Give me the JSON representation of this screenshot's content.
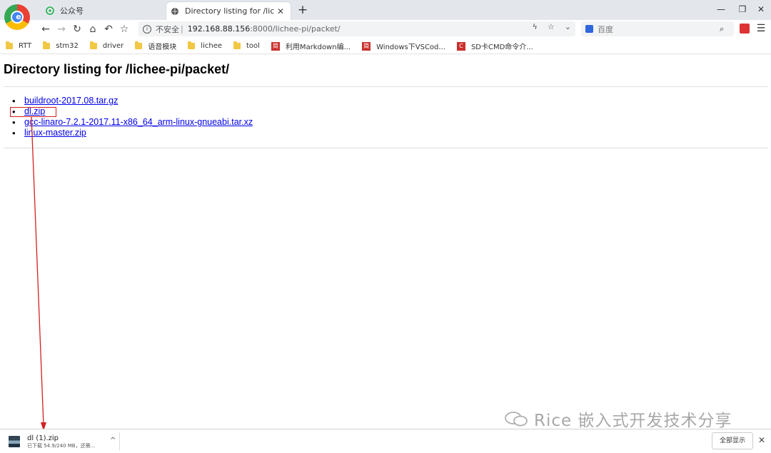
{
  "tabs": [
    {
      "title": "公众号",
      "icon": "wechat-icon"
    },
    {
      "title": "Directory listing for /lichee-pi/",
      "icon": "globe-icon",
      "close": "✕"
    }
  ],
  "new_tab": "+",
  "window_controls": [
    "—",
    "❐",
    "✕"
  ],
  "nav": {
    "back": "←",
    "forward": "→",
    "reload": "↻",
    "home": "⌂",
    "undo": "↶",
    "star": "☆"
  },
  "address": {
    "insecure_label": "不安全",
    "separator": "|",
    "host": "192.168.88.156",
    "rest": ":8000/lichee-pi/packet/"
  },
  "omni_icons": {
    "bolt": "ϟ",
    "star": "☆",
    "chevron": "⌄"
  },
  "search": {
    "placeholder": "百度",
    "button": "⌕"
  },
  "menu": "☰",
  "bookmarks": [
    {
      "label": "RTT",
      "type": "folder"
    },
    {
      "label": "stm32",
      "type": "folder"
    },
    {
      "label": "driver",
      "type": "folder"
    },
    {
      "label": "语音模块",
      "type": "folder"
    },
    {
      "label": "lichee",
      "type": "folder"
    },
    {
      "label": "tool",
      "type": "folder"
    },
    {
      "label": "利用Markdown编...",
      "type": "page",
      "badge": "简"
    },
    {
      "label": "Windows下VSCod...",
      "type": "page",
      "badge": "简"
    },
    {
      "label": "SD卡CMD命令介...",
      "type": "page",
      "badge": "C"
    }
  ],
  "page": {
    "heading": "Directory listing for /lichee-pi/packet/",
    "files": [
      "buildroot-2017.08.tar.gz",
      "dl.zip",
      "gcc-linaro-7.2.1-2017.11-x86_64_arm-linux-gnueabi.tar.xz",
      "linux-master.zip"
    ]
  },
  "watermark": "Rice 嵌入式开发技术分享",
  "download": {
    "name": "dl (1).zip",
    "status": "已下载 54.9/240 MB，还需...",
    "chevron": "^"
  },
  "show_all": "全部显示",
  "shelf_close": "✕",
  "colors": {
    "link": "#0000ee",
    "annotation": "#d32020"
  }
}
